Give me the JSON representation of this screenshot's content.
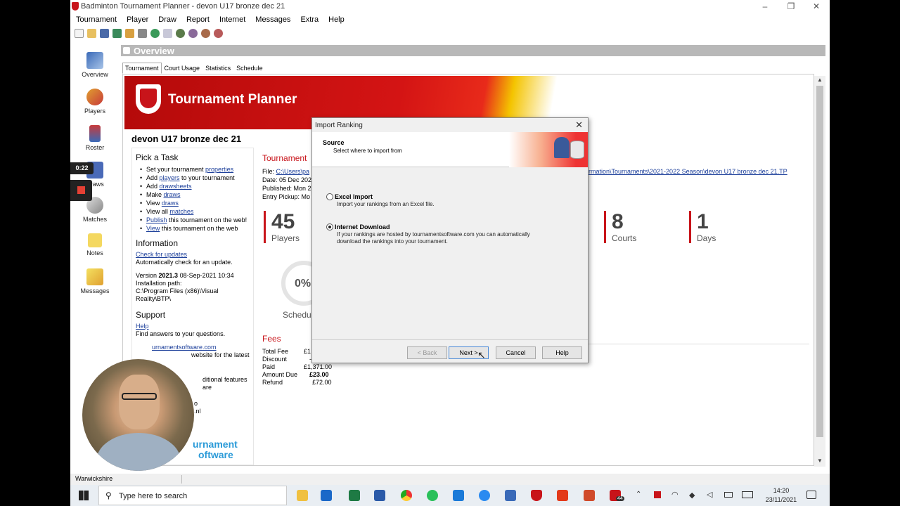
{
  "window": {
    "title": "Badminton Tournament Planner - devon U17 bronze dec 21"
  },
  "menu": [
    "Tournament",
    "Player",
    "Draw",
    "Report",
    "Internet",
    "Messages",
    "Extra",
    "Help"
  ],
  "nav": [
    {
      "label": "Overview",
      "icon": "overview-icon"
    },
    {
      "label": "Players",
      "icon": "players-icon"
    },
    {
      "label": "Roster",
      "icon": "roster-icon"
    },
    {
      "label": "Draws",
      "icon": "draws-icon"
    },
    {
      "label": "Matches",
      "icon": "matches-icon"
    },
    {
      "label": "Notes",
      "icon": "notes-icon"
    },
    {
      "label": "Messages",
      "icon": "messages-icon"
    }
  ],
  "overview_header": "Overview",
  "tabs": [
    "Tournament",
    "Court Usage",
    "Statistics",
    "Schedule"
  ],
  "banner_title": "Tournament Planner",
  "tournament_name": "devon U17 bronze dec 21",
  "pick_task": {
    "heading": "Pick a Task",
    "items": [
      {
        "pre": "Set your tournament ",
        "link": "properties",
        "post": ""
      },
      {
        "pre": "Add ",
        "link": "players",
        "post": " to your tournament"
      },
      {
        "pre": "Add ",
        "link": "drawsheets",
        "post": ""
      },
      {
        "pre": "Make ",
        "link": "draws",
        "post": ""
      },
      {
        "pre": "View ",
        "link": "draws",
        "post": ""
      },
      {
        "pre": "View all ",
        "link": "matches",
        "post": ""
      },
      {
        "pre": "",
        "link": "Publish",
        "post": " this tournament on the web!"
      },
      {
        "pre": "",
        "link": "View",
        "post": " this tournament on the web"
      }
    ]
  },
  "information": {
    "heading": "Information",
    "check_link": "Check for updates",
    "check_desc": "Automatically check for an update.",
    "version_pre": "Version ",
    "version": "2021.3",
    "version_date": " 08-Sep-2021 10:34",
    "install_label": "Installation path:",
    "install_path": "C:\\Program Files (x86)\\Visual Reality\\BTP\\"
  },
  "support": {
    "heading": "Support",
    "help_link": "Help",
    "help_desc": "Find answers to your questions.",
    "site_link": "urnamentsoftware.com",
    "site_desc": "website for the latest",
    "more_desc": "ditional features are",
    "line_o": "o",
    "line_nl": ".nl"
  },
  "brand_bottom": [
    "urnament",
    "oftware"
  ],
  "tournament_info": {
    "heading": "Tournament",
    "file_label": "File: ",
    "file_value": "C:\\Users\\pa",
    "file_tail": "rmation\\Tournaments\\2021-2022 Season\\devon U17 bronze dec 21.TP",
    "date": "Date: 05 Dec 2021",
    "published": "Published: Mon 2",
    "entry": "Entry Pickup: Mo"
  },
  "stats": [
    {
      "num": "45",
      "label": "Players"
    },
    {
      "num": "8",
      "label": "Courts"
    },
    {
      "num": "1",
      "label": "Days"
    }
  ],
  "schedule_pct": "0%",
  "schedule_label": "Schedu",
  "fees": {
    "heading": "Fees",
    "rows": [
      {
        "label": "Total Fee",
        "value": "£1"
      },
      {
        "label": "Discount",
        "value": "-"
      },
      {
        "label": "Paid",
        "value": "£1,371.00"
      },
      {
        "label": "Amount Due",
        "value": "£23.00"
      },
      {
        "label": "Refund",
        "value": "£72.00"
      }
    ]
  },
  "dialog": {
    "title": "Import Ranking",
    "source": "Source",
    "source_sub": "Select where to import from",
    "option1": "Excel Import",
    "option1_desc": "Import your rankings from an Excel file.",
    "option2": "Internet Download",
    "option2_desc1": "If your rankings are hosted by tournamentsoftware.com you can automatically",
    "option2_desc2": "download the rankings into your tournament.",
    "selected": 2,
    "buttons": {
      "back": "< Back",
      "next": "Next >",
      "cancel": "Cancel",
      "help": "Help"
    }
  },
  "statusbar": "Warwickshire",
  "recording_time": "0:22",
  "taskbar": {
    "search_placeholder": "Type here to search",
    "time": "14:20",
    "date": "23/11/2021",
    "badge": "44"
  },
  "colors": {
    "accent": "#c8141a",
    "link": "#1c3f9a"
  }
}
